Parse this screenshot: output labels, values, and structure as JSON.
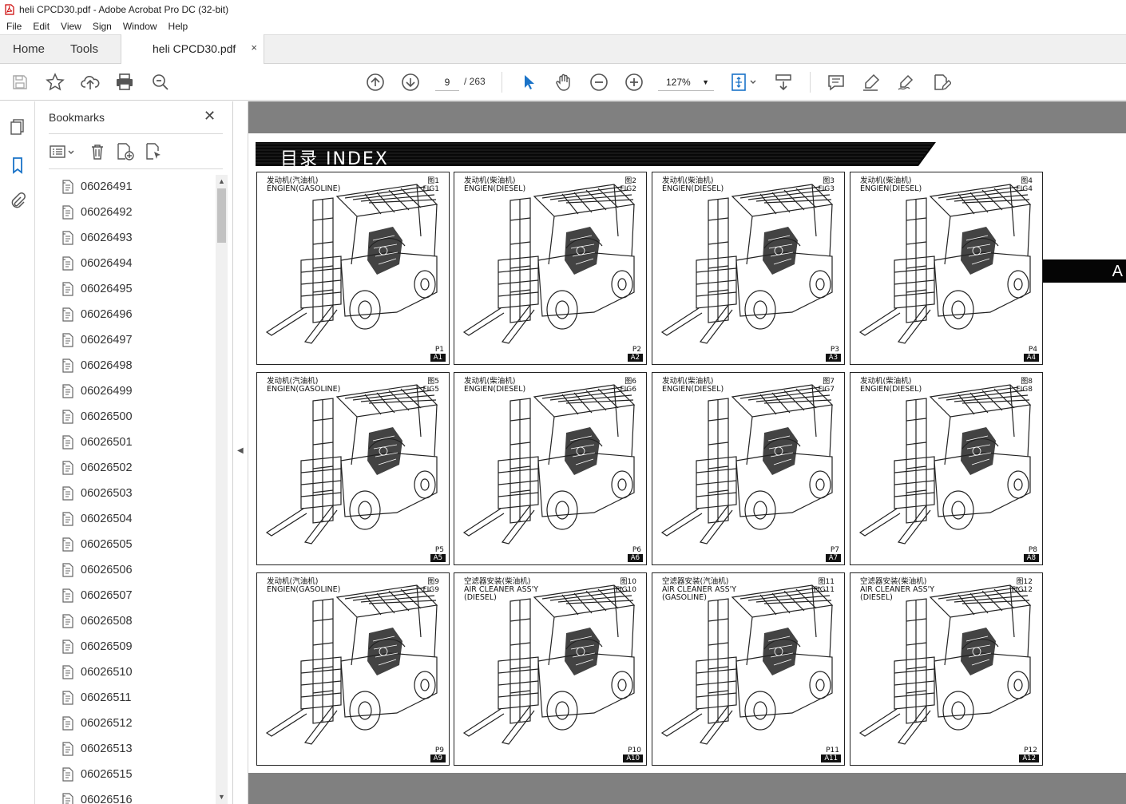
{
  "window": {
    "title": "heli CPCD30.pdf - Adobe Acrobat Pro DC (32-bit)"
  },
  "menu": [
    "File",
    "Edit",
    "View",
    "Sign",
    "Window",
    "Help"
  ],
  "tabs": {
    "home": "Home",
    "tools": "Tools",
    "document": "heli CPCD30.pdf",
    "close": "×"
  },
  "toolbar": {
    "page_current": "9",
    "page_total": "/ 263",
    "zoom": "127%",
    "zoom_caret": "▼",
    "icons": [
      "save-icon",
      "star-icon",
      "upload-cloud-icon",
      "print-icon",
      "zoom-search-icon",
      "page-up-icon",
      "page-down-icon",
      "select-arrow-icon",
      "hand-icon",
      "zoom-out-icon",
      "zoom-in-icon",
      "fit-page-icon",
      "scroll-mode-icon",
      "comment-icon",
      "highlight-pen-icon",
      "sign-icon",
      "fill-sign-icon"
    ]
  },
  "left_rail": {
    "icons": [
      "pages-icon",
      "bookmark-icon",
      "attachment-icon"
    ]
  },
  "bookmarks": {
    "title": "Bookmarks",
    "close": "✕",
    "items": [
      "06026491",
      "06026492",
      "06026493",
      "06026494",
      "06026495",
      "06026496",
      "06026497",
      "06026498",
      "06026499",
      "06026500",
      "06026501",
      "06026502",
      "06026503",
      "06026504",
      "06026505",
      "06026506",
      "06026507",
      "06026508",
      "06026509",
      "06026510",
      "06026511",
      "06026512",
      "06026513",
      "06026515",
      "06026516"
    ],
    "scroll_up": "▲",
    "scroll_down": "▼"
  },
  "splitter": {
    "arrow": "◀"
  },
  "page": {
    "heading": "目录  INDEX",
    "side_tab": "A",
    "figures": [
      {
        "caption": "发动机(汽油机)\nENGIEN(GASOLINE)",
        "fig": "图1\nFIG1",
        "p": "P1",
        "a": "A1"
      },
      {
        "caption": "发动机(柴油机)\nENGIEN(DIESEL)",
        "fig": "图2\nFIG2",
        "p": "P2",
        "a": "A2"
      },
      {
        "caption": "发动机(柴油机)\nENGIEN(DIESEL)",
        "fig": "图3\nFIG3",
        "p": "P3",
        "a": "A3"
      },
      {
        "caption": "发动机(柴油机)\nENGIEN(DIESEL)",
        "fig": "图4\nFIG4",
        "p": "P4",
        "a": "A4"
      },
      {
        "caption": "发动机(汽油机)\nENGIEN(GASOLINE)",
        "fig": "图5\nFIG5",
        "p": "P5",
        "a": "A5"
      },
      {
        "caption": "发动机(柴油机)\nENGIEN(DIESEL)",
        "fig": "图6\nFIG6",
        "p": "P6",
        "a": "A6"
      },
      {
        "caption": "发动机(柴油机)\nENGIEN(DIESEL)",
        "fig": "图7\nFIG7",
        "p": "P7",
        "a": "A7"
      },
      {
        "caption": "发动机(柴油机)\nENGIEN(DIESEL)",
        "fig": "图8\nFIG8",
        "p": "P8",
        "a": "A8"
      },
      {
        "caption": "发动机(汽油机)\nENGIEN(GASOLINE)",
        "fig": "图9\nFIG9",
        "p": "P9",
        "a": "A9"
      },
      {
        "caption": "空滤器安装(柴油机)\nAIR CLEANER ASS'Y\n(DIESEL)",
        "fig": "图10\nFIG10",
        "p": "P10",
        "a": "A10"
      },
      {
        "caption": "空滤器安装(汽油机)\nAIR CLEANER ASS'Y\n(GASOLINE)",
        "fig": "图11\nFIG11",
        "p": "P11",
        "a": "A11"
      },
      {
        "caption": "空滤器安装(柴油机)\nAIR CLEANER ASS'Y\n(DIESEL)",
        "fig": "图12\nFIG12",
        "p": "P12",
        "a": "A12"
      }
    ]
  }
}
